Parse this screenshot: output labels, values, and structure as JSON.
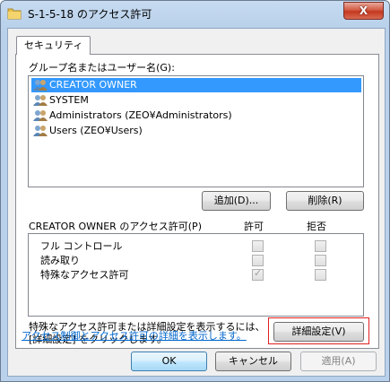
{
  "window": {
    "title": "S-1-5-18 のアクセス許可",
    "close_label": "X"
  },
  "tabs": [
    {
      "label": "セキュリティ"
    }
  ],
  "principals": {
    "label": "グループ名またはユーザー名(G):",
    "items": [
      {
        "label": "CREATOR OWNER",
        "selected": true
      },
      {
        "label": "SYSTEM",
        "selected": false
      },
      {
        "label": "Administrators (ZEO¥Administrators)",
        "selected": false
      },
      {
        "label": "Users (ZEO¥Users)",
        "selected": false
      }
    ],
    "add_label": "追加(D)...",
    "remove_label": "削除(R)"
  },
  "permissions": {
    "header_label": "CREATOR OWNER のアクセス許可(P)",
    "allow_header": "許可",
    "deny_header": "拒否",
    "rows": [
      {
        "label": "フル コントロール",
        "allow": false,
        "deny": false
      },
      {
        "label": "読み取り",
        "allow": false,
        "deny": false
      },
      {
        "label": "特殊なアクセス許可",
        "allow": true,
        "deny": false
      }
    ]
  },
  "advanced": {
    "hint_line1": "特殊なアクセス許可または詳細設定を表示するには、",
    "hint_line2": "[詳細設定] をクリックします。",
    "button_label": "詳細設定(V)"
  },
  "help_link": "アクセス制御とアクセス許可の詳細を表示します。",
  "footer": {
    "ok_label": "OK",
    "cancel_label": "キャンセル",
    "apply_label": "適用(A)"
  }
}
